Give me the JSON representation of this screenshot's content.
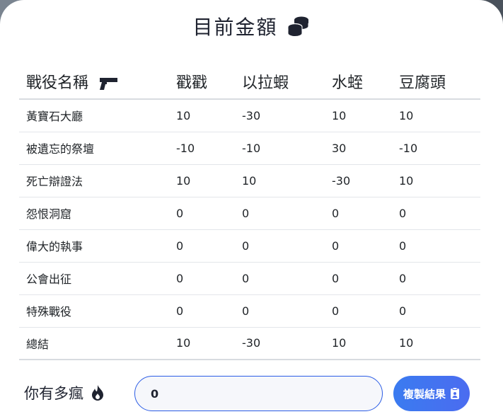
{
  "header": {
    "title": "目前金額",
    "icon": "coins-icon"
  },
  "table": {
    "headers": [
      "戰役名稱",
      "戳戳",
      "以拉蝦",
      "水蛭",
      "豆腐頭"
    ],
    "header_icon": "gun-icon",
    "rows": [
      {
        "name": "黃寶石大廳",
        "values": [
          "10",
          "-30",
          "10",
          "10"
        ]
      },
      {
        "name": "被遺忘的祭壇",
        "values": [
          "-10",
          "-10",
          "30",
          "-10"
        ]
      },
      {
        "name": "死亡辯證法",
        "values": [
          "10",
          "10",
          "-30",
          "10"
        ]
      },
      {
        "name": "怨恨洞窟",
        "values": [
          "0",
          "0",
          "0",
          "0"
        ]
      },
      {
        "name": "偉大的執事",
        "values": [
          "0",
          "0",
          "0",
          "0"
        ]
      },
      {
        "name": "公會出征",
        "values": [
          "0",
          "0",
          "0",
          "0"
        ]
      },
      {
        "name": "特殊戰役",
        "values": [
          "0",
          "0",
          "0",
          "0"
        ]
      },
      {
        "name": "總結",
        "values": [
          "10",
          "-30",
          "10",
          "10"
        ]
      }
    ]
  },
  "footer": {
    "crazy_label": "你有多瘋",
    "crazy_icon": "fire-icon",
    "crazy_value": "0",
    "copy_label": "複製結果",
    "copy_icon": "clipboard-icon"
  },
  "colors": {
    "accent": "#3a7bf0",
    "text": "#212529"
  }
}
